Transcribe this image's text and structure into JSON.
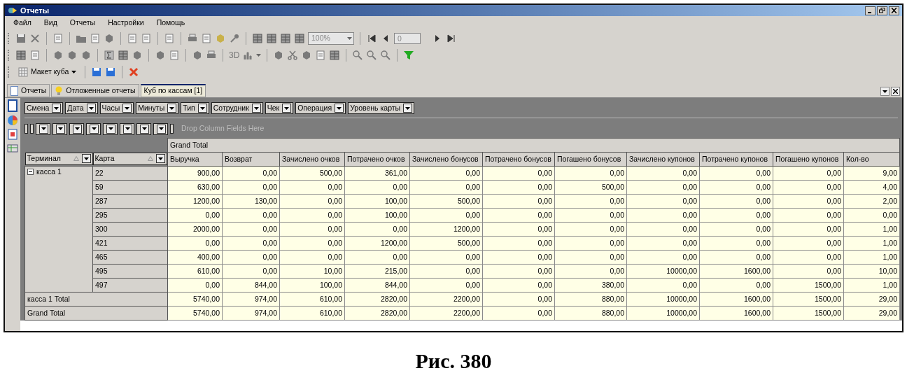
{
  "window": {
    "title": "Отчеты"
  },
  "menu": [
    "Файл",
    "Вид",
    "Отчеты",
    "Настройки",
    "Помощь"
  ],
  "toolbar": {
    "zoom": "100%",
    "page": "0",
    "label_3d": "3D",
    "layout_button": "Макет куба"
  },
  "tabs": [
    {
      "label": "Отчеты",
      "selected": false
    },
    {
      "label": "Отложенные отчеты",
      "selected": false
    },
    {
      "label": "Куб по кассам [1]",
      "selected": true
    }
  ],
  "filter_fields": [
    "Смена",
    "Дата",
    "Часы",
    "Минуты",
    "Тип",
    "Сотрудник",
    "Чек",
    "Операция",
    "Уровень карты"
  ],
  "column_area": {
    "placeholder": "Drop Column Fields Here"
  },
  "table": {
    "header_group": "Grand Total",
    "row_headers": [
      "Терминал",
      "Карта"
    ],
    "columns": [
      "Выручка",
      "Возврат",
      "Зачислено очков",
      "Потрачено очков",
      "Зачислено бонусов",
      "Потрачено бонусов",
      "Погашено бонусов",
      "Зачислено купонов",
      "Потрачено купонов",
      "Погашено купонов",
      "Кол-во"
    ],
    "groups": [
      {
        "label": "касса 1",
        "expanded": true,
        "rows": [
          {
            "card": "22",
            "values": [
              "900,00",
              "0,00",
              "500,00",
              "361,00",
              "0,00",
              "0,00",
              "0,00",
              "0,00",
              "0,00",
              "0,00",
              "9,00"
            ]
          },
          {
            "card": "59",
            "values": [
              "630,00",
              "0,00",
              "0,00",
              "0,00",
              "0,00",
              "0,00",
              "500,00",
              "0,00",
              "0,00",
              "0,00",
              "4,00"
            ]
          },
          {
            "card": "287",
            "values": [
              "1200,00",
              "130,00",
              "0,00",
              "100,00",
              "500,00",
              "0,00",
              "0,00",
              "0,00",
              "0,00",
              "0,00",
              "2,00"
            ]
          },
          {
            "card": "295",
            "values": [
              "0,00",
              "0,00",
              "0,00",
              "100,00",
              "0,00",
              "0,00",
              "0,00",
              "0,00",
              "0,00",
              "0,00",
              "0,00"
            ]
          },
          {
            "card": "300",
            "values": [
              "2000,00",
              "0,00",
              "0,00",
              "0,00",
              "1200,00",
              "0,00",
              "0,00",
              "0,00",
              "0,00",
              "0,00",
              "1,00"
            ]
          },
          {
            "card": "421",
            "values": [
              "0,00",
              "0,00",
              "0,00",
              "1200,00",
              "500,00",
              "0,00",
              "0,00",
              "0,00",
              "0,00",
              "0,00",
              "1,00"
            ]
          },
          {
            "card": "465",
            "values": [
              "400,00",
              "0,00",
              "0,00",
              "0,00",
              "0,00",
              "0,00",
              "0,00",
              "0,00",
              "0,00",
              "0,00",
              "1,00"
            ]
          },
          {
            "card": "495",
            "values": [
              "610,00",
              "0,00",
              "10,00",
              "215,00",
              "0,00",
              "0,00",
              "0,00",
              "10000,00",
              "1600,00",
              "0,00",
              "10,00"
            ]
          },
          {
            "card": "497",
            "values": [
              "0,00",
              "844,00",
              "100,00",
              "844,00",
              "0,00",
              "0,00",
              "380,00",
              "0,00",
              "0,00",
              "1500,00",
              "1,00"
            ]
          }
        ],
        "total_label": "касса 1 Total",
        "total": [
          "5740,00",
          "974,00",
          "610,00",
          "2820,00",
          "2200,00",
          "0,00",
          "880,00",
          "10000,00",
          "1600,00",
          "1500,00",
          "29,00"
        ]
      }
    ],
    "grand_total": {
      "label": "Grand Total",
      "values": [
        "5740,00",
        "974,00",
        "610,00",
        "2820,00",
        "2200,00",
        "0,00",
        "880,00",
        "10000,00",
        "1600,00",
        "1500,00",
        "29,00"
      ]
    }
  },
  "caption": "Рис. 380"
}
